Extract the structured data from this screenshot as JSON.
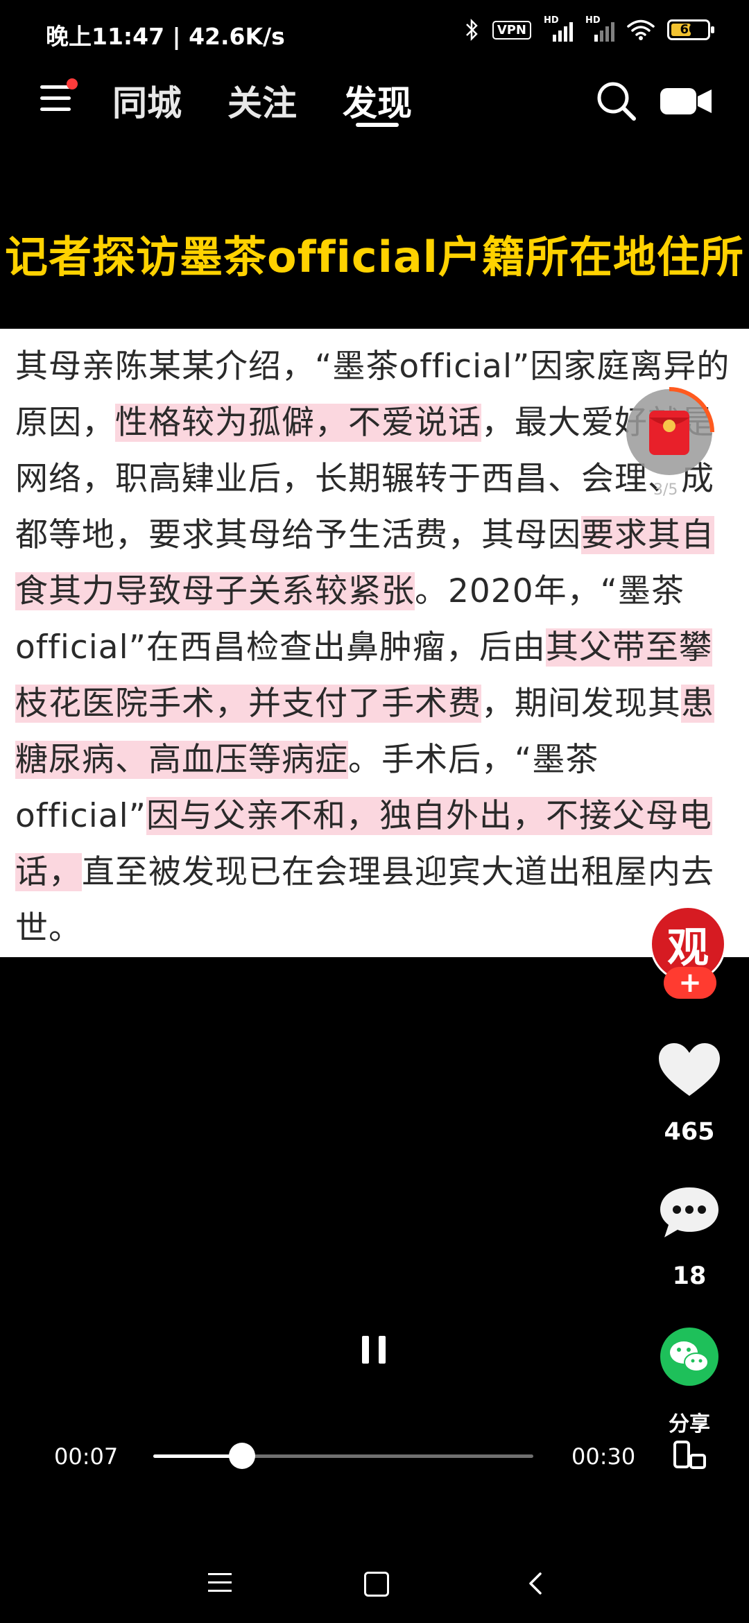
{
  "status_bar": {
    "time_and_speed": "晚上11:47 | 42.6K/s",
    "vpn_label": "VPN",
    "hd_label_1": "HD",
    "hd_label_2": "HD",
    "battery_level": "60",
    "battery_fraction": 0.6,
    "icons": [
      "bluetooth-icon",
      "vpn-icon",
      "signal-icon",
      "signal-icon",
      "wifi-icon",
      "battery-icon"
    ]
  },
  "top_nav": {
    "tabs": [
      {
        "label": "同城"
      },
      {
        "label": "关注"
      },
      {
        "label": "发现"
      }
    ],
    "active_tab": "发现",
    "icons": [
      "menu-icon",
      "search-icon",
      "camera-icon"
    ]
  },
  "video": {
    "title_banner": "记者探访墨茶official户籍所在地住所",
    "article": {
      "s1": "其母亲陈某某介绍，“墨茶official”因家庭离异的原因，",
      "h1": "性格较为孤僻，不爱说话",
      "s2": "，最大爱好就是网络，职高肄业后，长期辗转于西昌、会理、成都等地，要求其母给予生活费，其母因",
      "h2": "要求其自食其力导致母子关系较紧张",
      "s3": "。2020年，“墨茶official”在西昌检查出鼻肿瘤，后由",
      "h3": "其父带至攀枝花医院手术，并支付了手术费",
      "s4": "，期间发现其",
      "h4": "患糖尿病、高血压等病症",
      "s5": "。手术后，“墨茶official”",
      "h5": "因与父亲不和，独自外出，不接父母电话，",
      "s6": "直至被发现已在会理县迎宾大道出租屋内去世。"
    },
    "highlight_color": "#fbd7df",
    "banner_color": "#ffd200"
  },
  "red_packet": {
    "counter": "3/5"
  },
  "right_rail": {
    "avatar_text": "观",
    "follow_label": "+",
    "likes": "465",
    "comments": "18",
    "share_label": "分享"
  },
  "player": {
    "current_time": "00:07",
    "total_time": "00:30",
    "progress": 0.233
  }
}
